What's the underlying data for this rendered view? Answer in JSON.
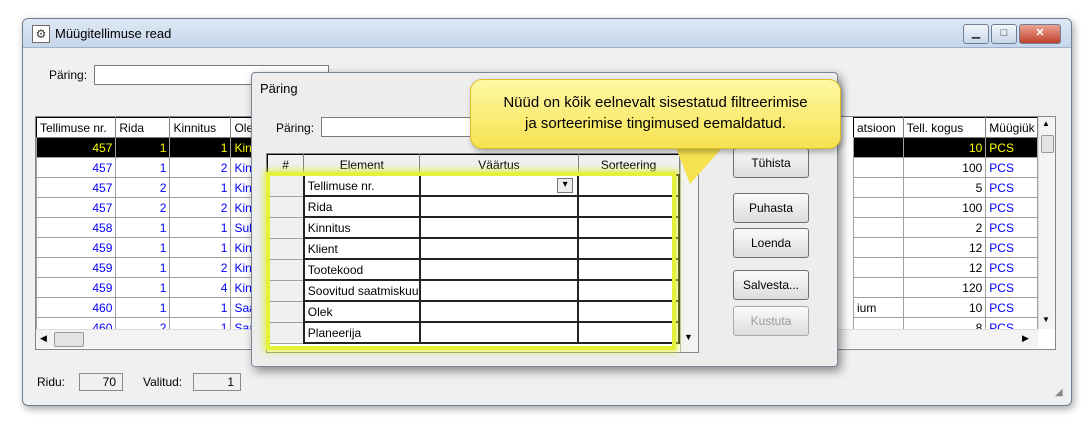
{
  "window": {
    "title": "Müügitellimuse read",
    "minimize_icon": "minimize-icon",
    "maximize_icon": "maximize-icon",
    "close_icon": "close-icon",
    "query_label": "Päring:",
    "query_value": ""
  },
  "grid": {
    "columns": [
      "Tellimuse nr.",
      "Rida",
      "Kinnitus",
      "Olek"
    ],
    "right_columns": [
      "atsioon",
      "Tell. kogus",
      "Müügiük"
    ],
    "rows": [
      {
        "order": "457",
        "line": "1",
        "conf": "1",
        "state": "Kinn",
        "loc": "",
        "qty": "10",
        "unit": "PCS"
      },
      {
        "order": "457",
        "line": "1",
        "conf": "2",
        "state": "Kinn",
        "loc": "",
        "qty": "100",
        "unit": "PCS"
      },
      {
        "order": "457",
        "line": "2",
        "conf": "1",
        "state": "Kinn",
        "loc": "",
        "qty": "5",
        "unit": "PCS"
      },
      {
        "order": "457",
        "line": "2",
        "conf": "2",
        "state": "Kinn",
        "loc": "",
        "qty": "100",
        "unit": "PCS"
      },
      {
        "order": "458",
        "line": "1",
        "conf": "1",
        "state": "Sule",
        "loc": "",
        "qty": "2",
        "unit": "PCS"
      },
      {
        "order": "459",
        "line": "1",
        "conf": "1",
        "state": "Kinn",
        "loc": "",
        "qty": "12",
        "unit": "PCS"
      },
      {
        "order": "459",
        "line": "1",
        "conf": "2",
        "state": "Kinn",
        "loc": "",
        "qty": "12",
        "unit": "PCS"
      },
      {
        "order": "459",
        "line": "1",
        "conf": "4",
        "state": "Kinn",
        "loc": "",
        "qty": "120",
        "unit": "PCS"
      },
      {
        "order": "460",
        "line": "1",
        "conf": "1",
        "state": "Saat",
        "loc": "ium",
        "qty": "10",
        "unit": "PCS"
      },
      {
        "order": "460",
        "line": "2",
        "conf": "1",
        "state": "Saat",
        "loc": "",
        "qty": "8",
        "unit": "PCS"
      }
    ],
    "selected_row": 0
  },
  "status": {
    "rows_label": "Ridu:",
    "rows_value": "70",
    "selected_label": "Valitud:",
    "selected_value": "1"
  },
  "dialog": {
    "title": "Päring",
    "query_label": "Päring:",
    "columns": [
      "#",
      "Element",
      "Väärtus",
      "Sorteering"
    ],
    "elements": [
      "Tellimuse nr.",
      "Rida",
      "Kinnitus",
      "Klient",
      "Tootekood",
      "Soovitud saatmiskuu",
      "Olek",
      "Planeerija"
    ],
    "buttons": {
      "cancel": "Tühista",
      "clear": "Puhasta",
      "load": "Loenda",
      "save": "Salvesta...",
      "delete": "Kustuta"
    }
  },
  "callout": {
    "line1": "Nüüd on kõik eelnevalt sisestatud filtreerimise",
    "line2": "ja sorteerimise tingimused eemaldatud."
  },
  "colors": {
    "selected_row_bg": "#000000",
    "selected_row_text": "#ffff00",
    "value_text": "#0000ff",
    "callout_bg": "#f6e24f",
    "highlight": "#e6f23a"
  }
}
